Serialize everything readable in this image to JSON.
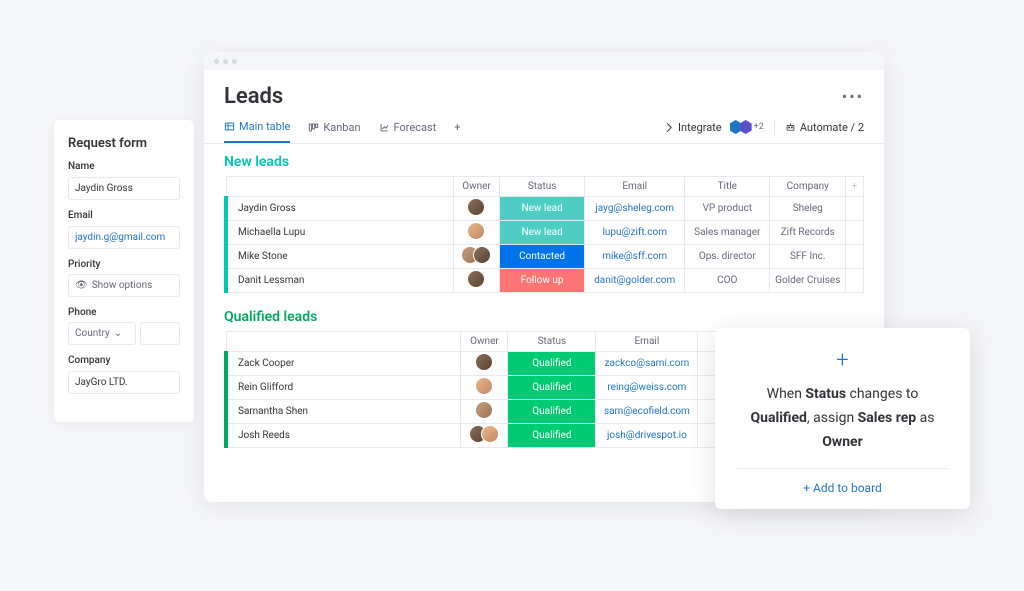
{
  "request_form": {
    "title": "Request form",
    "fields": {
      "name": {
        "label": "Name",
        "value": "Jaydin Gross"
      },
      "email": {
        "label": "Email",
        "value": "jaydin.g@gmail.com"
      },
      "priority": {
        "label": "Priority",
        "placeholder": "Show options"
      },
      "phone": {
        "label": "Phone",
        "country_label": "Country"
      },
      "company": {
        "label": "Company",
        "value": "JayGro LTD."
      }
    }
  },
  "board": {
    "title": "Leads",
    "views": [
      {
        "label": "Main table",
        "active": true
      },
      {
        "label": "Kanban",
        "active": false
      },
      {
        "label": "Forecast",
        "active": false
      }
    ],
    "integrate_label": "Integrate",
    "integration_extra": "+2",
    "automate_label": "Automate / 2",
    "columns": [
      "Owner",
      "Status",
      "Email",
      "Title",
      "Company"
    ],
    "groups": [
      {
        "name": "New leads",
        "color": "teal",
        "rows": [
          {
            "name": "Jaydin Gross",
            "owner_count": 1,
            "status": "New lead",
            "status_class": "newlead",
            "email": "jayg@sheleg.com",
            "title": "VP product",
            "company": "Sheleg"
          },
          {
            "name": "Michaella Lupu",
            "owner_count": 1,
            "status": "New lead",
            "status_class": "newlead",
            "email": "lupu@zift.com",
            "title": "Sales manager",
            "company": "Zift Records"
          },
          {
            "name": "Mike Stone",
            "owner_count": 2,
            "status": "Contacted",
            "status_class": "contacted",
            "email": "mike@sff.com",
            "title": "Ops. director",
            "company": "SFF Inc."
          },
          {
            "name": "Danit Lessman",
            "owner_count": 1,
            "status": "Follow up",
            "status_class": "followup",
            "email": "danit@golder.com",
            "title": "COO",
            "company": "Golder Cruises"
          }
        ]
      },
      {
        "name": "Qualified leads",
        "color": "green",
        "rows": [
          {
            "name": "Zack Cooper",
            "owner_count": 1,
            "status": "Qualified",
            "status_class": "qualified",
            "email": "zackco@sami.com",
            "title": "",
            "company": ""
          },
          {
            "name": "Rein Glifford",
            "owner_count": 1,
            "status": "Qualified",
            "status_class": "qualified",
            "email": "reing@weiss.com",
            "title": "",
            "company": ""
          },
          {
            "name": "Samantha Shen",
            "owner_count": 1,
            "status": "Qualified",
            "status_class": "qualified",
            "email": "sam@ecofield.com",
            "title": "",
            "company": ""
          },
          {
            "name": "Josh Reeds",
            "owner_count": 2,
            "status": "Qualified",
            "status_class": "qualified",
            "email": "josh@drivespot.io",
            "title": "",
            "company": ""
          }
        ]
      }
    ]
  },
  "automation": {
    "text_parts": [
      "When ",
      "Status",
      " changes to ",
      "Qualified",
      ", assign ",
      "Sales rep",
      " as ",
      "Owner"
    ],
    "add_label": "+ Add to board"
  }
}
